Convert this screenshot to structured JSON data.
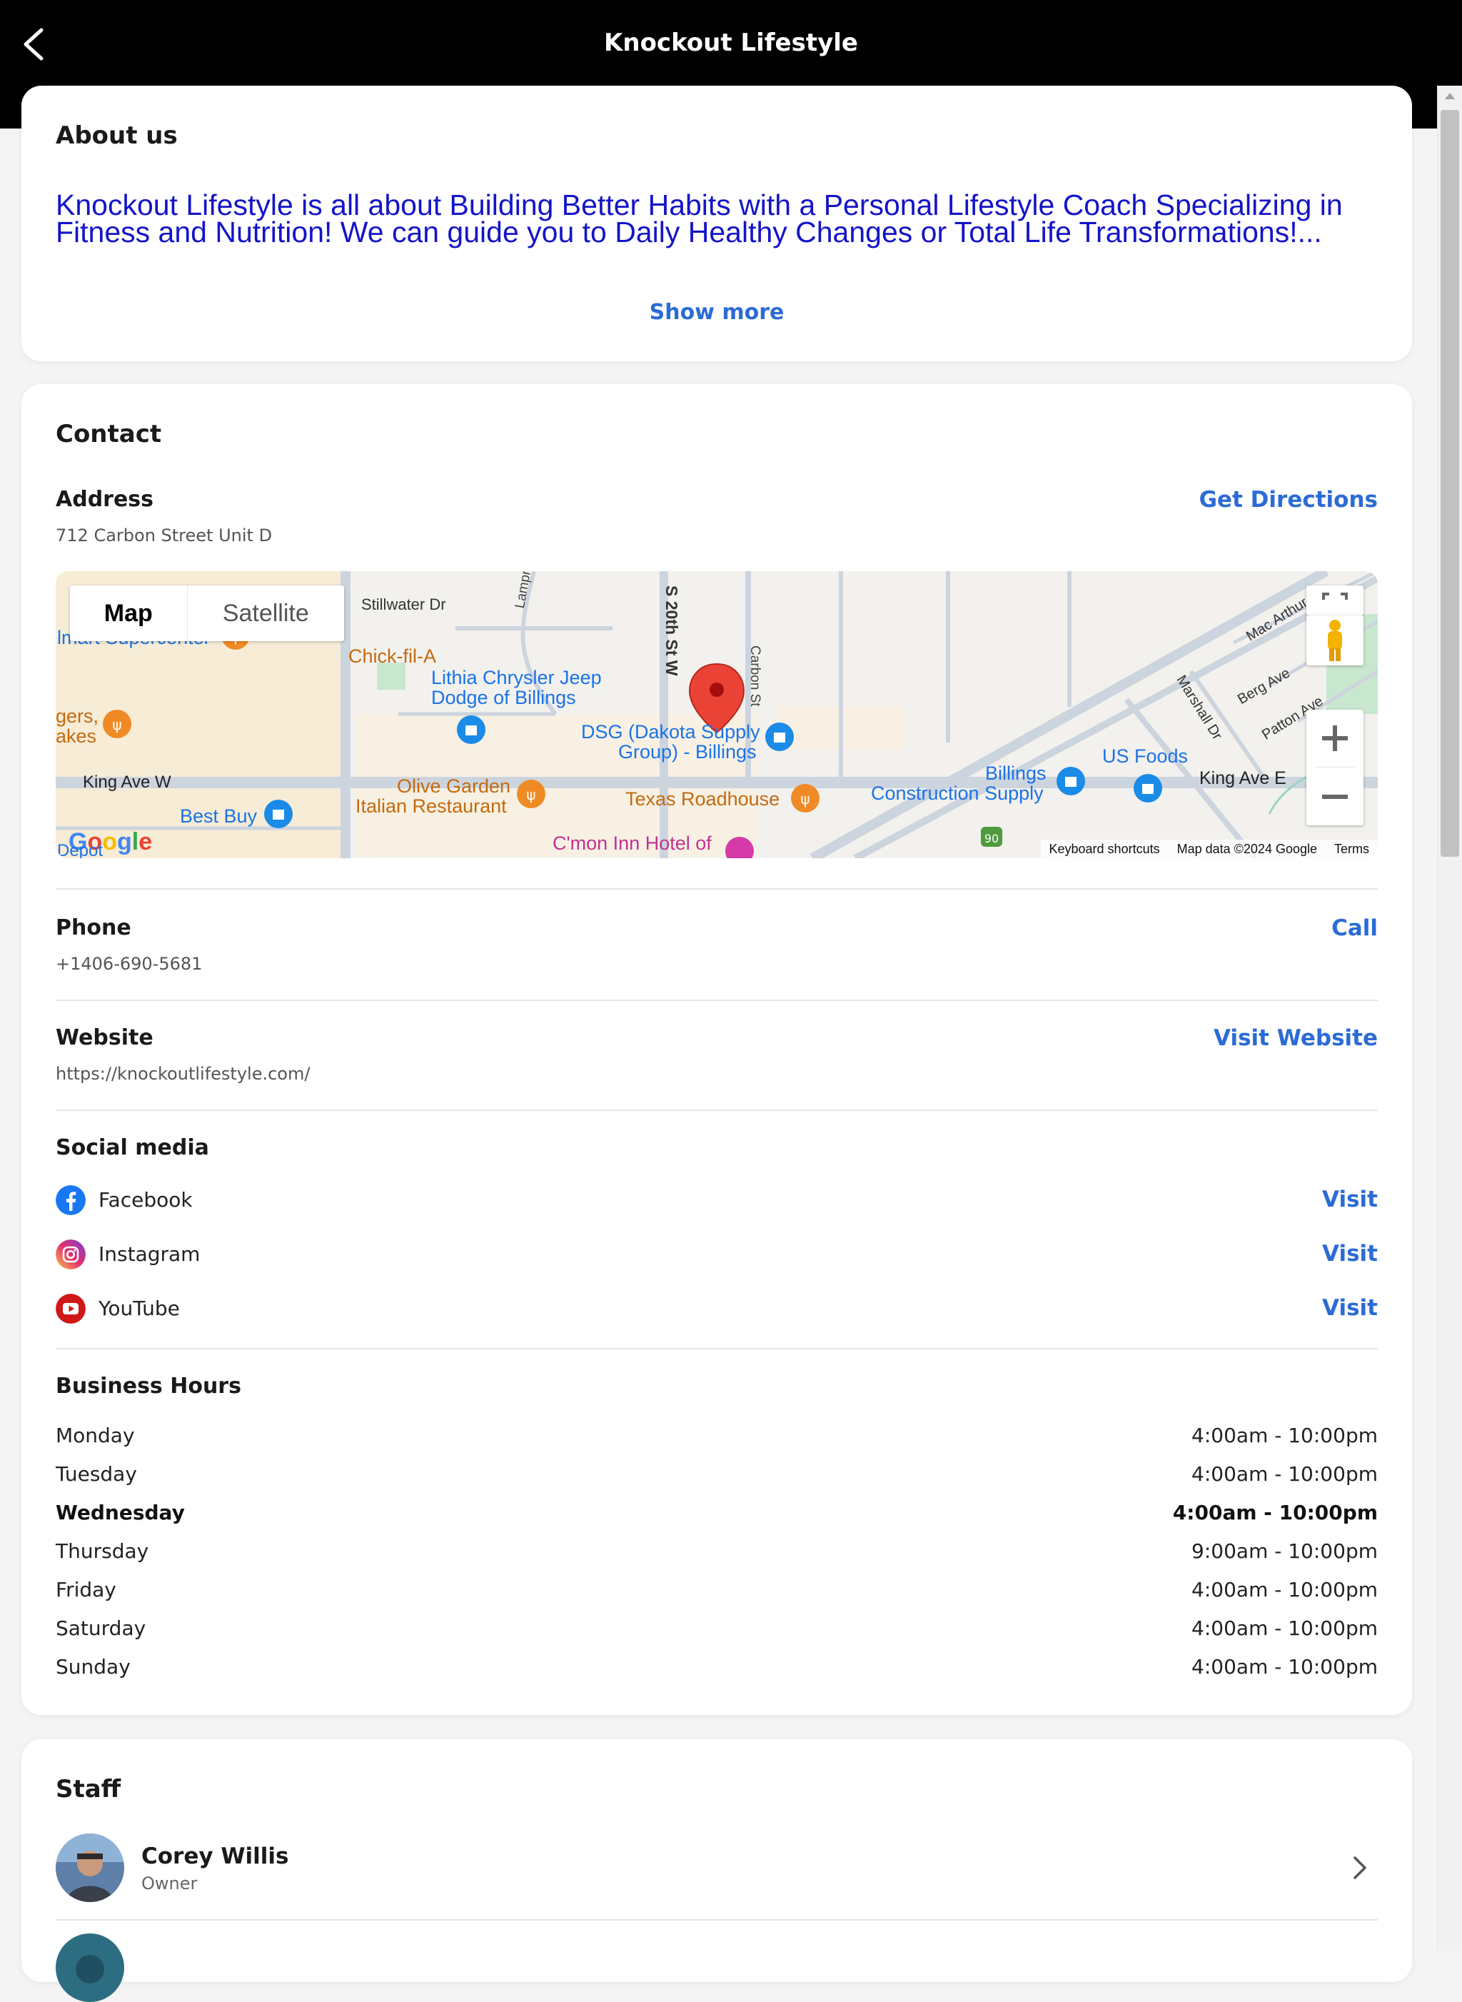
{
  "header": {
    "title": "Knockout Lifestyle",
    "back_icon": "chevron-left-icon"
  },
  "about": {
    "title": "About us",
    "text": "Knockout Lifestyle is all about Building Better Habits with a Personal Lifestyle Coach Specializing in Fitness and Nutrition! We can guide you to Daily Healthy Changes or Total Life Transformations!...",
    "show_more": "Show more"
  },
  "contact": {
    "title": "Contact",
    "address": {
      "label": "Address",
      "value": "712 Carbon Street Unit D",
      "action": "Get Directions"
    },
    "map": {
      "toggle_map": "Map",
      "toggle_satellite": "Satellite",
      "labels": {
        "stillwater": "Stillwater Dr",
        "lampman": "Lampman Dr",
        "s20th": "S 20th St W",
        "carbon": "Carbon St",
        "walmart": "lmart Supercenter",
        "chickfila": "Chick-fil-A",
        "lithia": "Lithia Chrysler Jeep",
        "lithia2": "Dodge of Billings",
        "burgers": "gers,",
        "burgers2": "akes",
        "dsg": "DSG (Dakota Supply",
        "dsg2": "Group) - Billings",
        "king_w": "King Ave W",
        "olive": "Olive Garden",
        "olive2": "Italian Restaurant",
        "texas": "Texas Roadhouse",
        "bestbuy": "Best Buy",
        "cmon": "C'mon Inn Hotel of",
        "depot": "Depot",
        "billings_cs": "Billings",
        "billings_cs2": "Construction Supply",
        "usfoods": "US Foods",
        "king_e": "King Ave E",
        "mac": "Mac Arthur Ave",
        "berg": "Berg Ave",
        "patton": "Patton Ave",
        "marshall": "Marshall Dr",
        "i90": "90"
      },
      "footer": {
        "shortcuts": "Keyboard shortcuts",
        "mapdata": "Map data ©2024 Google",
        "terms": "Terms"
      },
      "logo": "Google"
    },
    "phone": {
      "label": "Phone",
      "value": "+1406-690-5681",
      "action": "Call"
    },
    "website": {
      "label": "Website",
      "value": "https://knockoutlifestyle.com/",
      "action": "Visit Website"
    },
    "social": {
      "title": "Social media",
      "items": [
        {
          "name": "Facebook",
          "action": "Visit",
          "icon": "facebook-icon",
          "color": "#1877f2"
        },
        {
          "name": "Instagram",
          "action": "Visit",
          "icon": "instagram-icon",
          "color": "#d6249f"
        },
        {
          "name": "YouTube",
          "action": "Visit",
          "icon": "youtube-icon",
          "color": "#d01818"
        }
      ]
    },
    "hours": {
      "title": "Business Hours",
      "days": [
        {
          "day": "Monday",
          "time": "4:00am - 10:00pm"
        },
        {
          "day": "Tuesday",
          "time": "4:00am - 10:00pm"
        },
        {
          "day": "Wednesday",
          "time": "4:00am - 10:00pm"
        },
        {
          "day": "Thursday",
          "time": "9:00am - 10:00pm"
        },
        {
          "day": "Friday",
          "time": "4:00am - 10:00pm"
        },
        {
          "day": "Saturday",
          "time": "4:00am - 10:00pm"
        },
        {
          "day": "Sunday",
          "time": "4:00am - 10:00pm"
        }
      ]
    }
  },
  "staff": {
    "title": "Staff",
    "members": [
      {
        "name": "Corey Willis",
        "role": "Owner"
      }
    ]
  },
  "colors": {
    "accent": "#2b6bd6",
    "about_text": "#1414c8",
    "header_bg": "#000000",
    "map_pin": "#d93025"
  }
}
